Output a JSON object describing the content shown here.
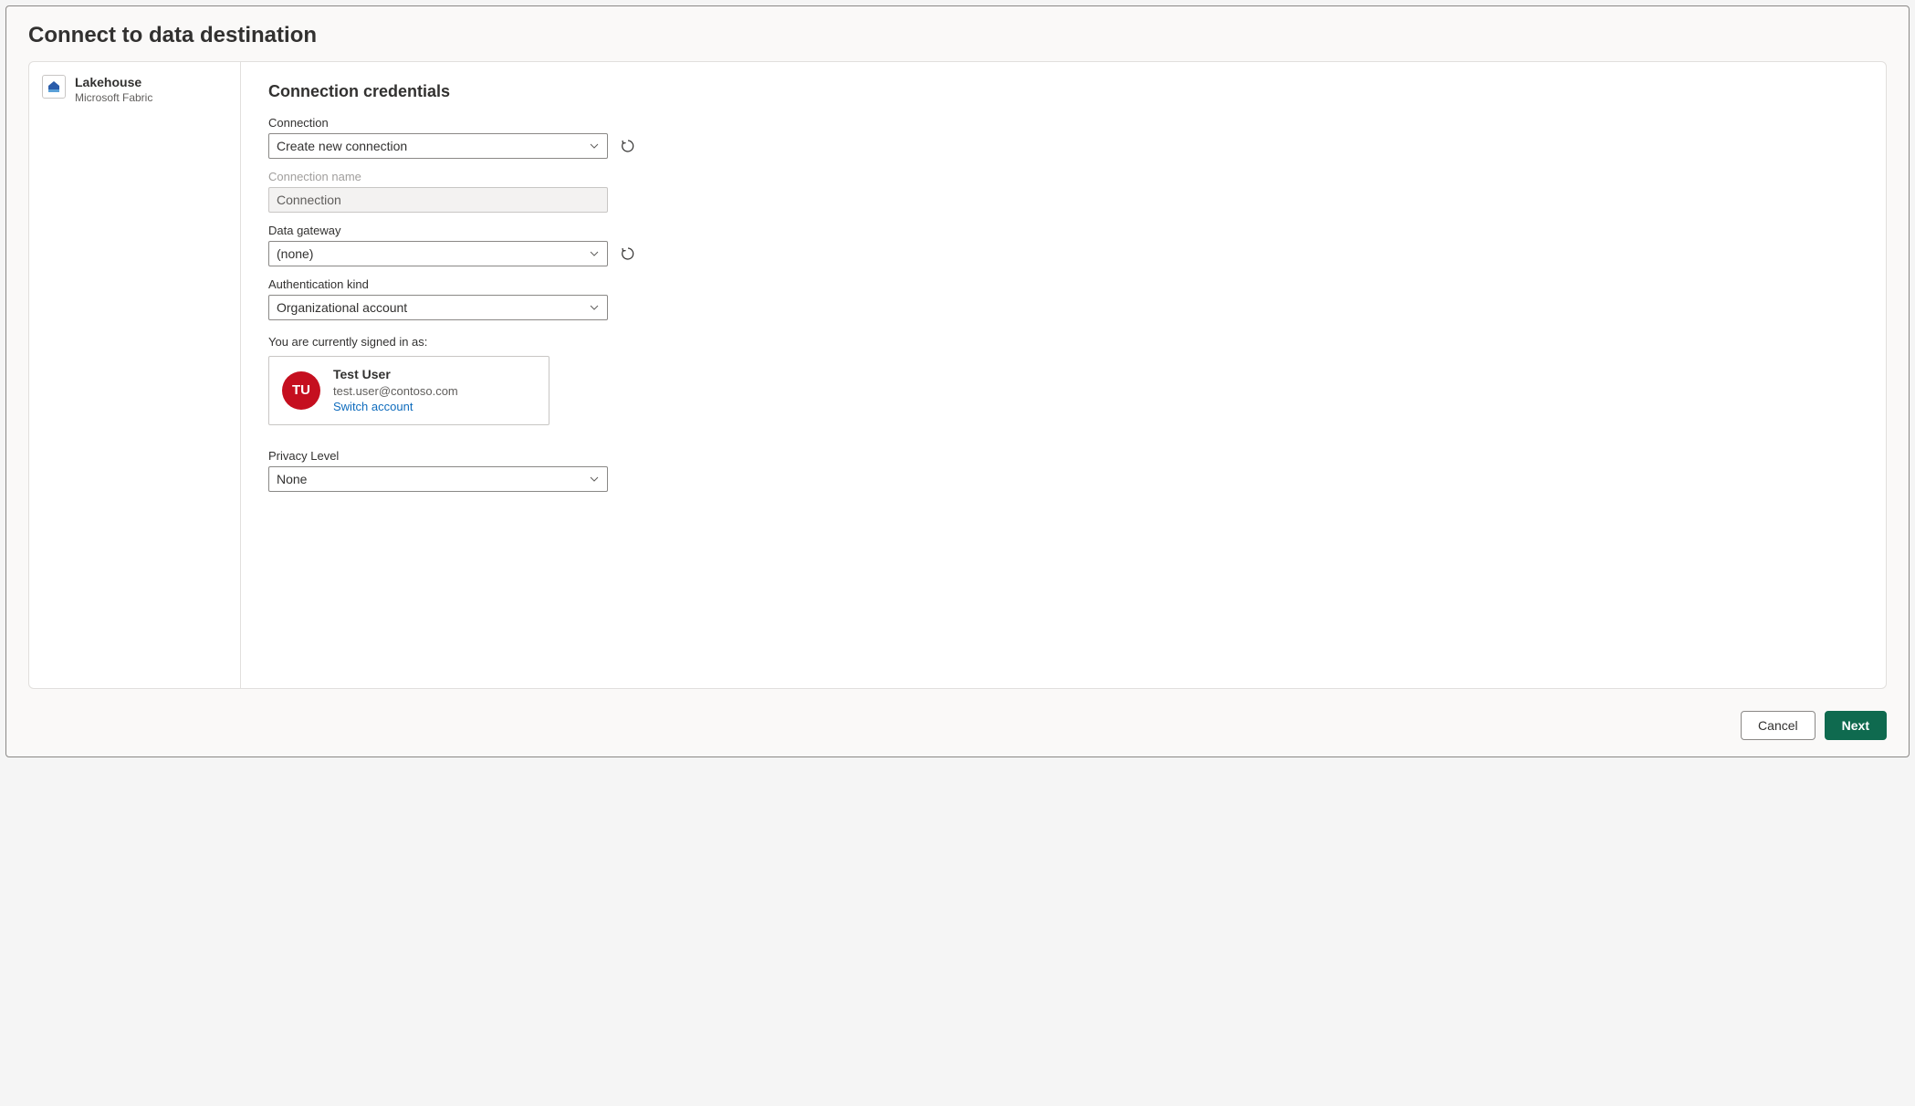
{
  "dialog": {
    "title": "Connect to data destination"
  },
  "sidebar": {
    "item": {
      "title": "Lakehouse",
      "subtitle": "Microsoft Fabric"
    }
  },
  "main": {
    "section_title": "Connection credentials",
    "connection": {
      "label": "Connection",
      "value": "Create new connection"
    },
    "connection_name": {
      "label": "Connection name",
      "placeholder": "Connection"
    },
    "data_gateway": {
      "label": "Data gateway",
      "value": "(none)"
    },
    "auth_kind": {
      "label": "Authentication kind",
      "value": "Organizational account"
    },
    "signed_in_label": "You are currently signed in as:",
    "user": {
      "initials": "TU",
      "name": "Test User",
      "email": "test.user@contoso.com",
      "switch_label": "Switch account"
    },
    "privacy": {
      "label": "Privacy Level",
      "value": "None"
    }
  },
  "footer": {
    "cancel": "Cancel",
    "next": "Next"
  }
}
